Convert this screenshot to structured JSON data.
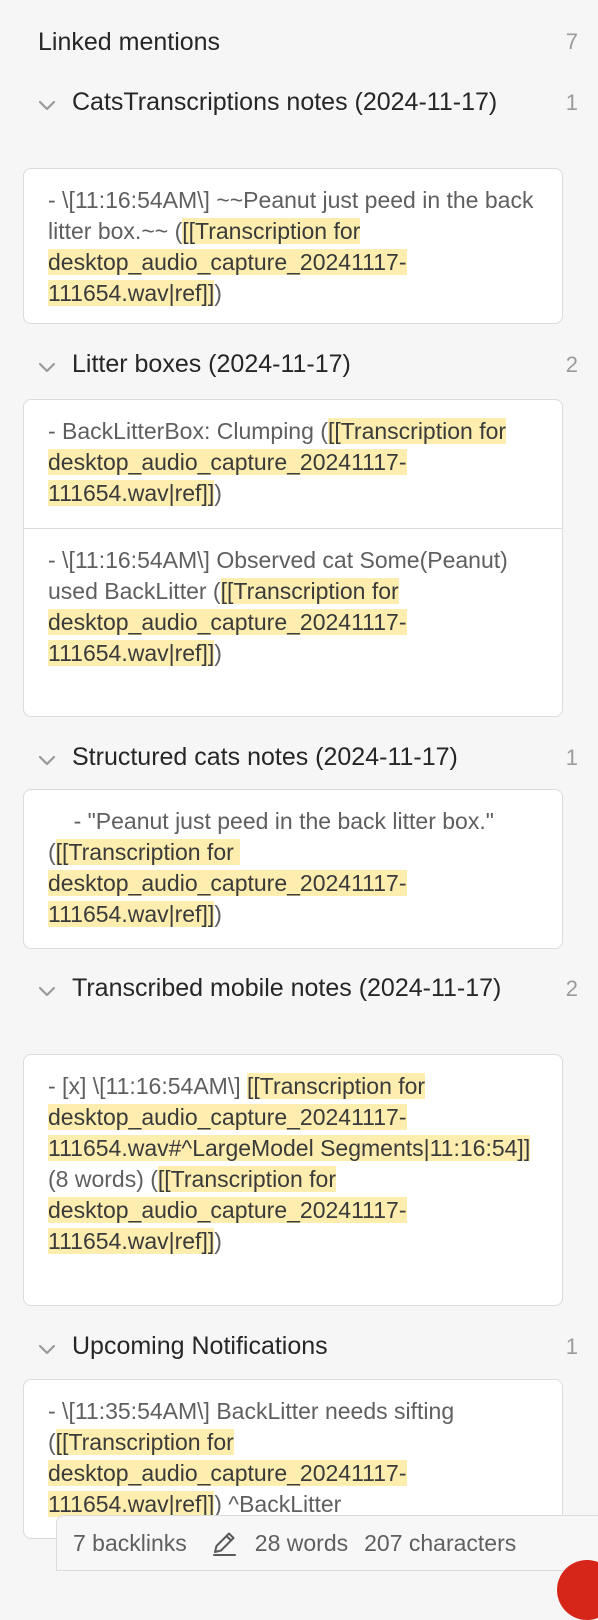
{
  "panel": {
    "title": "Linked mentions",
    "count": "7"
  },
  "groups": [
    {
      "title": "CatsTranscriptions notes (2024-11-17)",
      "count": "1",
      "entries": [
        {
          "pre": "- \\[11:16:54AM\\] ~~Peanut just peed in the back litter box.~~ (",
          "link": "[[Transcription for desktop_audio_capture_20241117-111654.wav|ref]]",
          "post": ")"
        }
      ]
    },
    {
      "title": "Litter boxes (2024-11-17)",
      "count": "2",
      "entries": [
        {
          "pre": "- BackLitterBox: Clumping (",
          "link": "[[Transcription for desktop_audio_capture_20241117-111654.wav|ref]]",
          "post": ")"
        },
        {
          "pre": "- \\[11:16:54AM\\] Observed cat Some(Peanut) used BackLitter (",
          "link": "[[Transcription for desktop_audio_capture_20241117-111654.wav|ref]]",
          "post": ")"
        }
      ]
    },
    {
      "title": "Structured cats notes (2024-11-17)",
      "count": "1",
      "entries": [
        {
          "pre": "    - \"Peanut just peed in the back litter box.\" (",
          "link": "[[Transcription for desktop_audio_capture_20241117-111654.wav|ref]]",
          "post": ")"
        }
      ]
    },
    {
      "title": "Transcribed mobile notes (2024-11-17)",
      "count": "2",
      "entries": [
        {
          "pre": "- [x] \\[11:16:54AM\\] ",
          "link": "[[Transcription for desktop_audio_capture_20241117-111654.wav#^LargeModel Segments|11:16:54]]",
          "mid": " (8 words) (",
          "link2": "[[Transcription for desktop_audio_capture_20241117-111654.wav|ref]]",
          "post": ")"
        }
      ]
    },
    {
      "title": "Upcoming Notifications",
      "count": "1",
      "entries": [
        {
          "pre": "- \\[11:35:54AM\\] BackLitter needs sifting (",
          "link": "[[Transcription for desktop_audio_capture_20241117-111654.wav|ref]]",
          "post": ") ^BackLitter"
        }
      ]
    }
  ],
  "status": {
    "backlinks": "7 backlinks",
    "words": "28 words",
    "characters": "207 characters"
  },
  "icons": {
    "chevron": "chevron-down-icon",
    "edit": "pencil-icon"
  },
  "colors": {
    "highlight": "#fdeeb0",
    "background": "#f6f6f6",
    "card": "#ffffff"
  }
}
